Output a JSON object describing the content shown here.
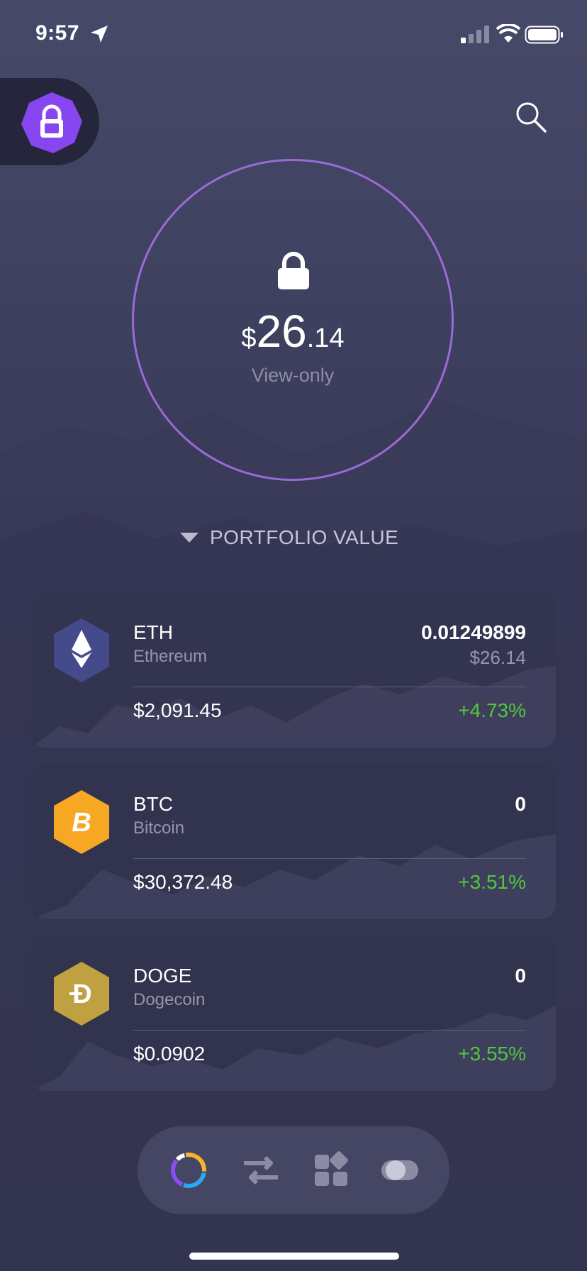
{
  "status_bar": {
    "time": "9:57",
    "icons": [
      "location-arrow-icon",
      "cellular-signal-icon",
      "wifi-icon",
      "battery-icon"
    ]
  },
  "header": {
    "lock_icon": "lock-badge-icon",
    "search_icon": "search-icon"
  },
  "portfolio": {
    "currency": "$",
    "amount_int": "26",
    "amount_dec": ".14",
    "mode": "View-only",
    "label": "PORTFOLIO VALUE",
    "accent_color": "#9a6bd6"
  },
  "assets": [
    {
      "symbol": "ETH",
      "name": "Ethereum",
      "amount": "0.01249899",
      "fiat_value": "$26.14",
      "price": "$2,091.45",
      "change": "+4.73%",
      "icon": "ethereum-icon"
    },
    {
      "symbol": "BTC",
      "name": "Bitcoin",
      "amount": "0",
      "price": "$30,372.48",
      "change": "+3.51%",
      "icon": "bitcoin-icon"
    },
    {
      "symbol": "DOGE",
      "name": "Dogecoin",
      "amount": "0",
      "price": "$0.0902",
      "change": "+3.55%",
      "icon": "dogecoin-icon"
    }
  ],
  "colors": {
    "positive": "#50c83c",
    "btc": "#f7a823",
    "doge": "#bfa142",
    "eth": "#454a8a"
  },
  "tab_bar": [
    {
      "name": "portfolio",
      "icon": "portfolio-donut-icon",
      "active": true
    },
    {
      "name": "exchange",
      "icon": "exchange-arrows-icon",
      "active": false
    },
    {
      "name": "apps",
      "icon": "apps-grid-icon",
      "active": false
    },
    {
      "name": "settings",
      "icon": "toggle-icon",
      "active": false
    }
  ]
}
